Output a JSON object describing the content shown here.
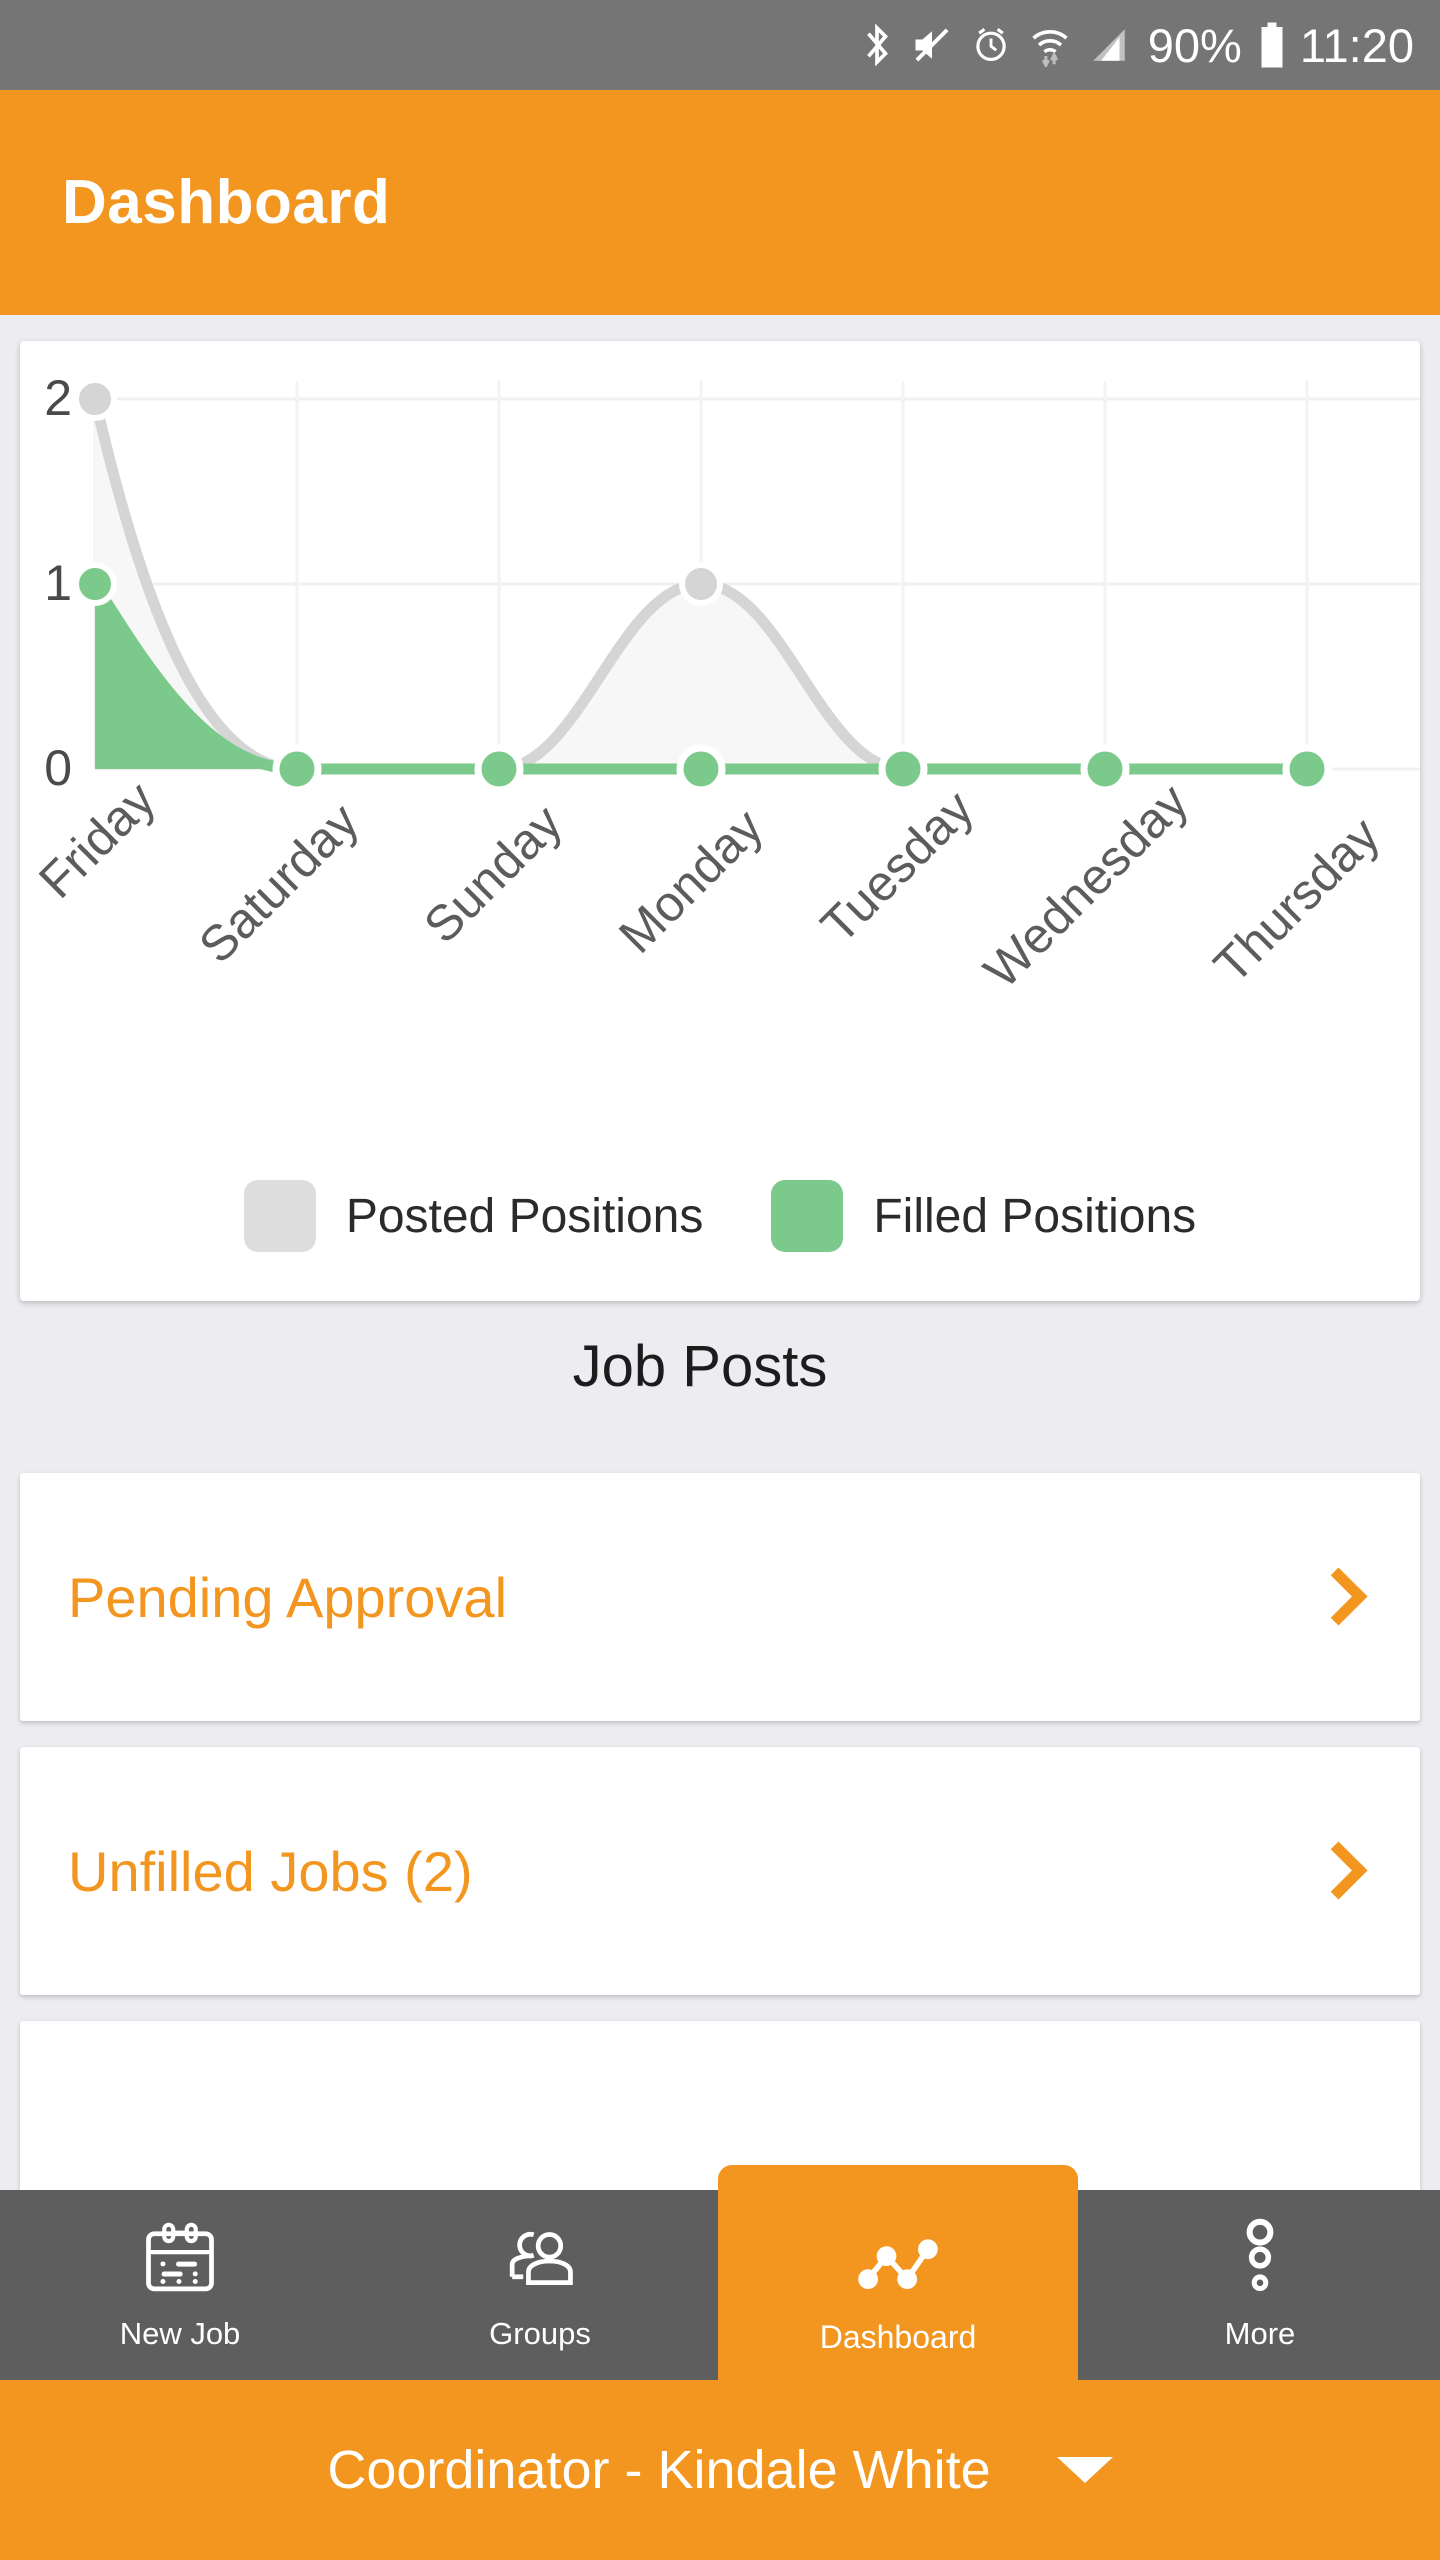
{
  "status_bar": {
    "battery_percent": "90%",
    "time": "11:20",
    "icons": [
      "bluetooth-icon",
      "mute-icon",
      "alarm-icon",
      "wifi-icon",
      "cellular-signal-icon",
      "battery-icon"
    ]
  },
  "app_bar": {
    "title": "Dashboard"
  },
  "chart_data": {
    "type": "area",
    "title": "",
    "xlabel": "",
    "ylabel": "",
    "categories": [
      "Friday",
      "Saturday",
      "Sunday",
      "Monday",
      "Tuesday",
      "Wednesday",
      "Thursday"
    ],
    "ytick_labels": [
      "0",
      "1",
      "2"
    ],
    "ylim": [
      0,
      2
    ],
    "grid": true,
    "legend_position": "bottom",
    "series": [
      {
        "name": "Posted Positions",
        "color": "#d9d9d9",
        "values": [
          2,
          0,
          0,
          1,
          0,
          0,
          0
        ]
      },
      {
        "name": "Filled Positions",
        "color": "#7cc98c",
        "values": [
          1,
          0,
          0,
          0,
          0,
          0,
          0
        ]
      }
    ]
  },
  "legend": [
    {
      "label": "Posted Positions",
      "color": "#dddddd"
    },
    {
      "label": "Filled Positions",
      "color": "#7cc98c"
    }
  ],
  "job_posts": {
    "heading": "Job Posts",
    "items": [
      {
        "label": "Pending Approval"
      },
      {
        "label": "Unfilled Jobs (2)"
      }
    ]
  },
  "bottom_nav": {
    "items": [
      {
        "label": "New Job",
        "icon": "calendar-icon",
        "active": false
      },
      {
        "label": "Groups",
        "icon": "people-icon",
        "active": false
      },
      {
        "label": "Dashboard",
        "icon": "line-chart-icon",
        "active": true
      },
      {
        "label": "More",
        "icon": "more-dots-icon",
        "active": false
      }
    ]
  },
  "role_bar": {
    "text": "Coordinator - Kindale White",
    "caret": "chevron-down-icon"
  },
  "colors": {
    "accent": "#f3961f",
    "status_bar": "#757575",
    "nav_bar": "#5e5e5e",
    "page_background": "#ededf1",
    "series_posted": "#d9d9d9",
    "series_filled": "#7cc98c"
  }
}
